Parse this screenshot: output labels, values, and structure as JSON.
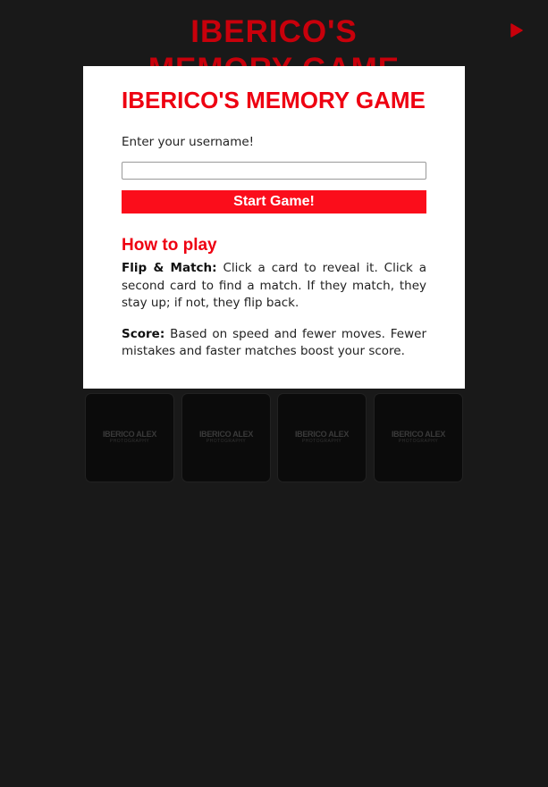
{
  "header": {
    "title": "IBERICO'S MEMORY GAME"
  },
  "icons": {
    "play": "play-icon"
  },
  "colors": {
    "accent": "#c8000b",
    "modal_title": "#ee0011",
    "button_bg": "#fb0d1b",
    "background": "#191919"
  },
  "cards": {
    "brand": "IBERICO ALEX",
    "sub": "PHOTOGRAPHY",
    "items": [
      {
        "face": "hidden"
      },
      {
        "face": "hidden"
      },
      {
        "face": "hidden"
      },
      {
        "face": "hidden"
      },
      {
        "face": "hidden"
      },
      {
        "face": "hidden"
      },
      {
        "face": "hidden"
      },
      {
        "face": "hidden"
      },
      {
        "face": "hidden"
      },
      {
        "face": "hidden"
      },
      {
        "face": "hidden"
      },
      {
        "face": "hidden"
      },
      {
        "face": "hidden"
      },
      {
        "face": "hidden"
      },
      {
        "face": "hidden"
      },
      {
        "face": "hidden"
      }
    ]
  },
  "modal": {
    "title": "IBERICO'S MEMORY GAME",
    "prompt": "Enter your username!",
    "username_value": "",
    "username_placeholder": "",
    "start_label": "Start Game!",
    "howto_title": "How to play",
    "rules": [
      {
        "term": "Flip & Match:",
        "text": " Click a card to reveal it. Click a second card to find a match. If they match, they stay up; if not, they flip back."
      },
      {
        "term": "Score:",
        "text": " Based on speed and fewer moves. Fewer mistakes and faster matches boost your score."
      }
    ]
  }
}
